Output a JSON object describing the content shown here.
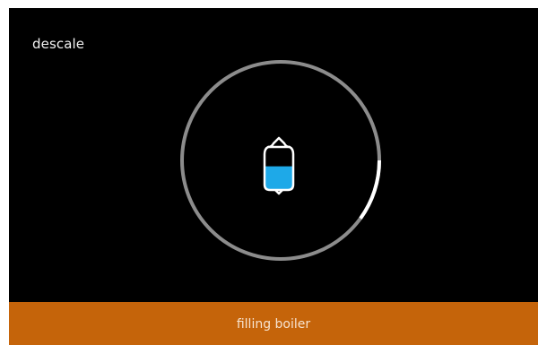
{
  "screen": {
    "title": "descale",
    "status": "filling boiler"
  },
  "progress": {
    "fraction": 0.1
  },
  "boiler": {
    "icon": "boiler-icon",
    "fill_level": 0.55
  },
  "colors": {
    "background": "#000000",
    "ring_track": "#8c8c8c",
    "ring_progress": "#ffffff",
    "water": "#1ea9e8",
    "status_bar": "#c5640a"
  }
}
